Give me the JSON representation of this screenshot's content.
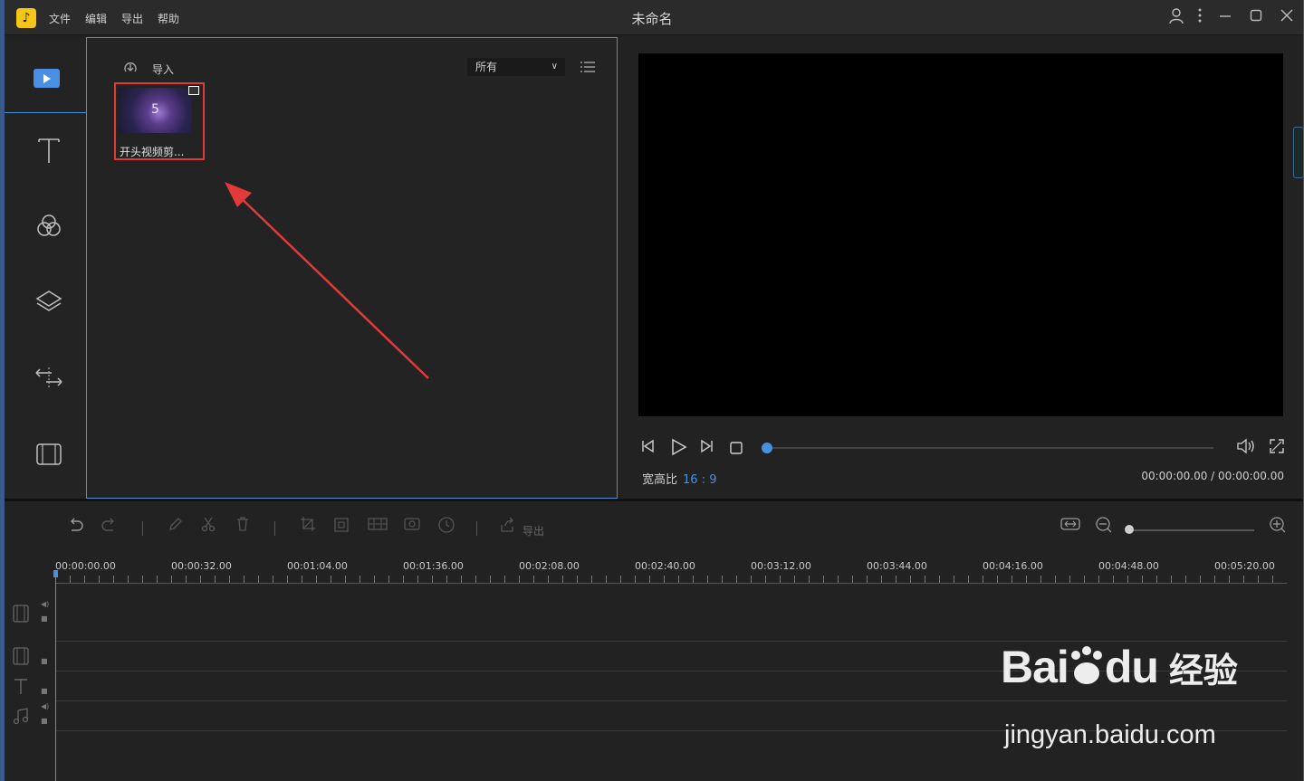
{
  "titlebar": {
    "logo_glyph": "",
    "menu": [
      "文件",
      "编辑",
      "导出",
      "帮助"
    ],
    "title": "未命名",
    "icons": [
      "user-icon",
      "more-icon",
      "minimize-icon",
      "maximize-icon",
      "close-icon"
    ]
  },
  "sidebar": {
    "items": [
      "media-icon",
      "text-icon",
      "filter-icon",
      "overlay-icon",
      "transition-icon",
      "element-icon"
    ]
  },
  "media": {
    "import_label": "导入",
    "filter_value": "所有",
    "items": [
      {
        "thumb_text": "5",
        "caption": "开头视频剪..."
      }
    ]
  },
  "preview": {
    "aspect_label": "宽高比",
    "aspect_value": "16 : 9",
    "time": "00:00:00.00 / 00:00:00.00",
    "progress": 0
  },
  "toolbar": {
    "export_label": "导出"
  },
  "timeline": {
    "ticks": [
      "00:00:00.00",
      "00:00:32.00",
      "00:01:04.00",
      "00:01:36.00",
      "00:02:08.00",
      "00:02:40.00",
      "00:03:12.00",
      "00:03:44.00",
      "00:04:16.00",
      "00:04:48.00",
      "00:05:20.00"
    ],
    "zoom_level": 0
  },
  "watermark": {
    "brand": "Bai",
    "brand2": "du",
    "cn": "经验",
    "url": "jingyan.baidu.com"
  },
  "colors": {
    "accent": "#4a90e2",
    "highlight_box": "#e23a3a",
    "arrow": "#e23a3a"
  }
}
